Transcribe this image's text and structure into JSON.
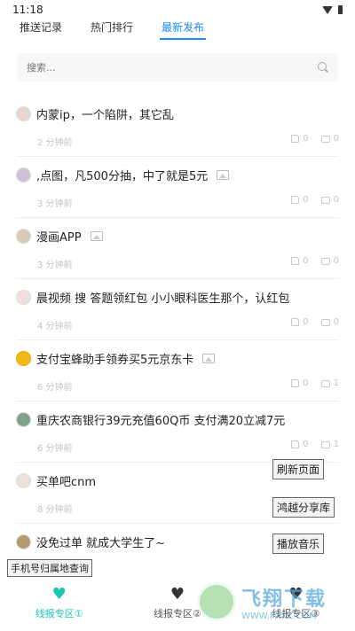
{
  "status": {
    "time": "11:18"
  },
  "tabs": [
    {
      "label": "推送记录"
    },
    {
      "label": "热门排行"
    },
    {
      "label": "最新发布"
    }
  ],
  "search": {
    "placeholder": "搜索..."
  },
  "posts": [
    {
      "title": "内蒙ip，一个陷阱，其它乱",
      "time": "2 分钟前",
      "likes": "0",
      "comments": "0"
    },
    {
      "title": ",点图，凡500分抽，中了就是5元",
      "time": "3 分钟前",
      "likes": "0",
      "comments": "0"
    },
    {
      "title": "漫画APP",
      "time": "3 分钟前",
      "likes": "0",
      "comments": "0"
    },
    {
      "title": "晨视频 搜 答题领红包 小小眼科医生那个，认红包",
      "time": "4 分钟前",
      "likes": "0",
      "comments": "0"
    },
    {
      "title": "支付宝蜂助手领券买5元京东卡",
      "time": "6 分钟前",
      "likes": "0",
      "comments": "1"
    },
    {
      "title": "重庆农商银行39元充值60Q币 支付满20立减7元",
      "time": "6 分钟前",
      "likes": "0",
      "comments": "1"
    },
    {
      "title": "买单吧cnm",
      "time": "8 分钟前",
      "likes": "",
      "comments": ""
    },
    {
      "title": "没免过单 就成大学生了~",
      "time": "",
      "likes": "",
      "comments": ""
    }
  ],
  "float_buttons": {
    "refresh": "刷新页面",
    "share": "鸿越分享库",
    "music": "播放音乐",
    "phone": "手机号归属地查询"
  },
  "bottom_nav": [
    {
      "label": "线报专区①"
    },
    {
      "label": "线报专区②"
    },
    {
      "label": "线报专区③"
    }
  ],
  "watermark": {
    "main": "飞翔下载",
    "url": "WWW.FXXZ.COM"
  },
  "colors": {
    "accent": "#1a8cff",
    "nav_active": "#1cc4b4"
  }
}
